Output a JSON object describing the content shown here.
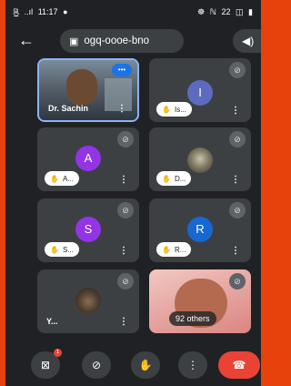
{
  "status": {
    "left": [
      "ℝ̲",
      "..ıl",
      "11:17",
      "●"
    ],
    "right": [
      "☸",
      "ℕ",
      "22",
      "◫",
      "▮"
    ]
  },
  "meeting": {
    "code": "ogq-oooe-bno"
  },
  "icons": {
    "back": "arrow-back-icon",
    "calendar": "calendar-icon",
    "audio": "speaker-icon",
    "mic_off": "mic-off-icon",
    "hand": "raise-hand-icon",
    "more": "more-vert-icon",
    "camera_off": "camera-off-icon",
    "end_call": "end-call-icon"
  },
  "tiles": [
    {
      "name": "Dr. Sachin",
      "type": "video"
    },
    {
      "name": "Is...",
      "initial": "I",
      "color": "#5c6bc0"
    },
    {
      "name": "A...",
      "initial": "A",
      "color": "#9334e6"
    },
    {
      "name": "D...",
      "type": "photo"
    },
    {
      "name": "S...",
      "initial": "S",
      "color": "#9334e6"
    },
    {
      "name": "R...",
      "initial": "R",
      "color": "#1967d2"
    },
    {
      "name": "Y...",
      "type": "photo"
    },
    {
      "name": "92 others",
      "type": "video"
    }
  ],
  "controls": {
    "badge": "1"
  },
  "colors": {
    "frame": "#e8420c",
    "screen_bg": "#202124",
    "tile_bg": "#3c4043",
    "end_call": "#ea4335"
  }
}
